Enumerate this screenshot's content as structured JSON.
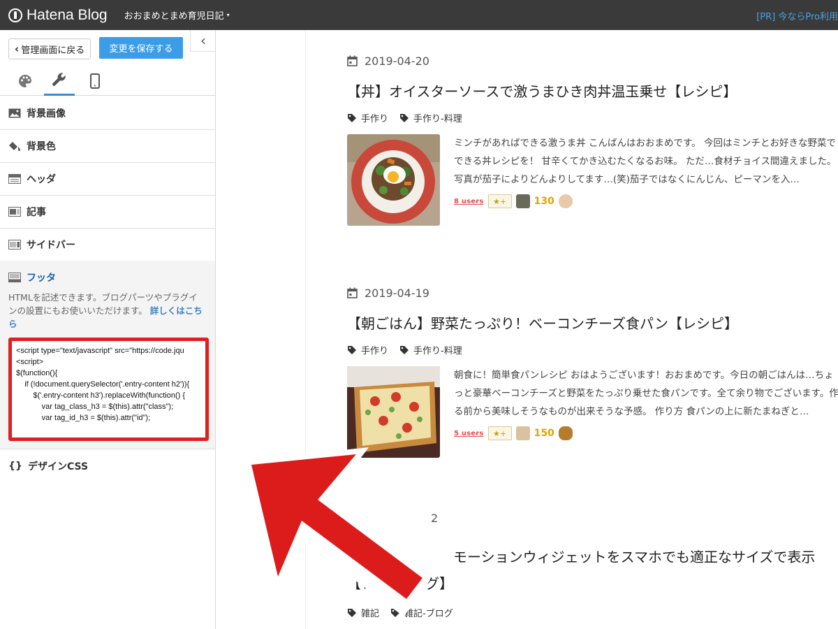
{
  "topbar": {
    "logo_text": "Hatena Blog",
    "blog_name": "おおまめとまめ育児日記",
    "blog_caret": "▾",
    "pr_text": "[PR] 今ならPro利用"
  },
  "sidebar": {
    "back_label": "管理画面に戻る",
    "back_icon": "chevron-left",
    "save_label": "変更を保存する",
    "collapse_icon": "‹",
    "tabs": [
      {
        "icon": "palette-icon",
        "active": false
      },
      {
        "icon": "wrench-icon",
        "active": true
      },
      {
        "icon": "smartphone-icon",
        "active": false
      }
    ],
    "sections": [
      {
        "label": "背景画像",
        "icon": "image-icon"
      },
      {
        "label": "背景色",
        "icon": "paint-bucket-icon"
      },
      {
        "label": "ヘッダ",
        "icon": "layout-header-icon"
      },
      {
        "label": "記事",
        "icon": "layout-article-icon"
      },
      {
        "label": "サイドバー",
        "icon": "layout-sidebar-icon"
      }
    ],
    "footer": {
      "label": "フッタ",
      "description": "HTMLを記述できます。ブログパーツやプラグインの設置にもお使いいただけます。",
      "link": "詳しくはこちら",
      "code": "<script type=\"text/javascript\" src=\"https://code.jqu\n<script>\n$(function(){\n    if (!document.querySelector('.entry-content h2')){\n        $('.entry-content h3').replaceWith(function() {\n            var tag_class_h3 = $(this).attr(\"class\");\n            var tag_id_h3 = $(this).attr(\"id\");"
    },
    "design_css": {
      "icon": "{}",
      "label": "デザインCSS"
    }
  },
  "entries": [
    {
      "date": "2019-04-20",
      "title": "【丼】オイスターソースで激うまひき肉丼温玉乗せ【レシピ】",
      "tags": [
        "手作り",
        "手作り-料理"
      ],
      "excerpt": "ミンチがあればできる激うま丼 こんばんはおおまめです。 今回はミンチとお好きな野菜でできる丼レシピを！ 甘辛くてかき込むたくなるお味。 ただ…食材チョイス間違えました。 写真が茄子によりどんよりしてます…(笑)茄子ではなくにんじん、ピーマンを入…",
      "users": "8 users",
      "star_label": "★+",
      "star_count": "130"
    },
    {
      "date": "2019-04-19",
      "title": "【朝ごはん】野菜たっぷり！ベーコンチーズ食パン【レシピ】",
      "tags": [
        "手作り",
        "手作り-料理"
      ],
      "excerpt": "朝食に！簡単食パンレシピ おはようございます！おおまめです。今日の朝ごはんは…ちょっと豪華ベーコンチーズと野菜をたっぷり乗せた食パンです。全て余り物でございます。作る前から美味しそうなものが出来そうな予感。 作り方 食パンの上に新たまねぎと…",
      "users": "5 users",
      "star_label": "★+",
      "star_count": "150"
    },
    {
      "date_fragment": "2",
      "title_line1": "モーションウィジェットをスマホでも適正なサイズで表示",
      "title_line2_a": "【レ",
      "title_line2_b": "グ】",
      "tags": [
        "雑記",
        "雑記-ブログ"
      ]
    }
  ],
  "colors": {
    "topbar_bg": "#3a3a3a",
    "save_button": "#3b9ce8",
    "highlight_red": "#e02020",
    "link_blue": "#3b82c4",
    "users_red": "#e34b4b",
    "star_gold": "#e4a400"
  }
}
